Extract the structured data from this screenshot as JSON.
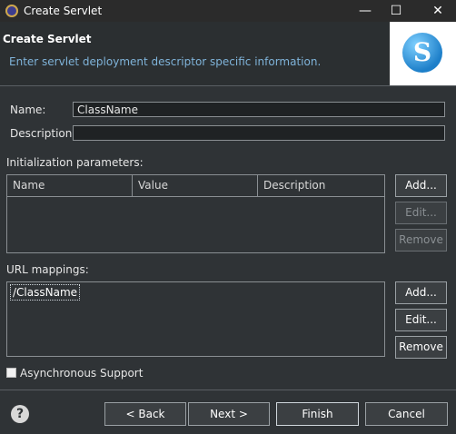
{
  "window": {
    "title": "Create Servlet",
    "minimize_glyph": "—",
    "maximize_glyph": "☐",
    "close_glyph": "✕"
  },
  "banner": {
    "title": "Create Servlet",
    "description": "Enter servlet deployment descriptor specific information.",
    "logo_letter": "S"
  },
  "form": {
    "name_label": "Name:",
    "name_value": "ClassName",
    "description_label": "Description:",
    "description_value": ""
  },
  "init_params": {
    "label": "Initialization parameters:",
    "columns": [
      "Name",
      "Value",
      "Description"
    ],
    "add_label": "Add...",
    "edit_label": "Edit...",
    "remove_label": "Remove"
  },
  "url_mappings": {
    "label": "URL mappings:",
    "items": [
      "/ClassName"
    ],
    "add_label": "Add...",
    "edit_label": "Edit...",
    "remove_label": "Remove"
  },
  "async": {
    "label": "Asynchronous Support",
    "checked": false
  },
  "footer": {
    "help_glyph": "?",
    "back_label": "< Back",
    "next_label": "Next >",
    "finish_label": "Finish",
    "cancel_label": "Cancel"
  }
}
